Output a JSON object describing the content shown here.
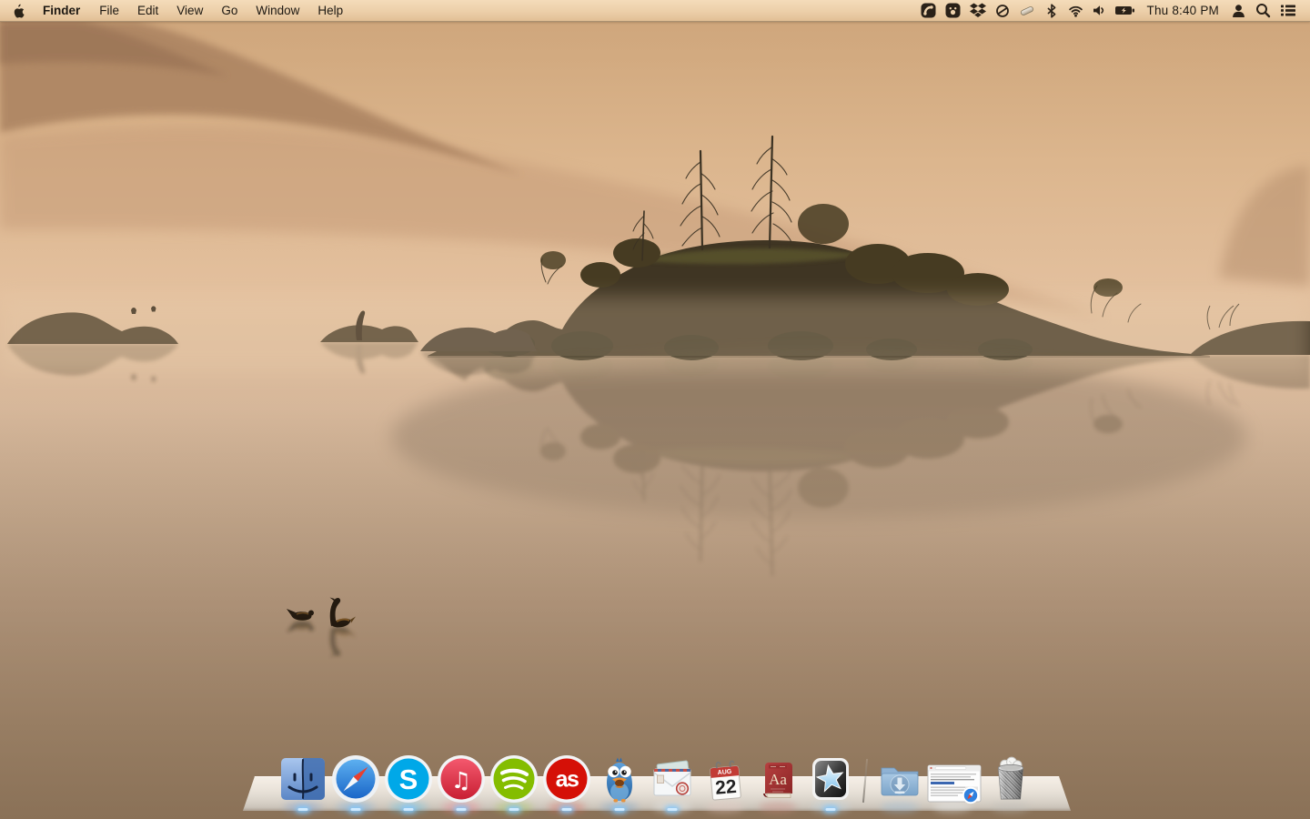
{
  "menu_bar": {
    "items": [
      {
        "label": "Finder",
        "bold": true
      },
      {
        "label": "File"
      },
      {
        "label": "Edit"
      },
      {
        "label": "View"
      },
      {
        "label": "Go"
      },
      {
        "label": "Window"
      },
      {
        "label": "Help"
      }
    ],
    "status": {
      "clock": "Thu 8:40 PM",
      "icons_left_to_right": [
        "phone-icon",
        "rounded-app-icon",
        "dropbox-icon",
        "circle-slash-icon",
        "pill-icon",
        "bluetooth-icon",
        "wifi-icon",
        "volume-icon",
        "battery-icon"
      ],
      "icons_after_clock": [
        "user-icon",
        "spotlight-icon",
        "notification-center-icon"
      ]
    }
  },
  "dock": {
    "items": [
      {
        "name": "finder",
        "running": true,
        "accent": "#5d87c6"
      },
      {
        "name": "safari",
        "running": true,
        "accent": "#2f7fd0"
      },
      {
        "name": "skype",
        "glyph": "S",
        "running": true,
        "accent": "#00a8e8"
      },
      {
        "name": "itunes",
        "glyph": "♫",
        "running": true,
        "accent": "#e83a50"
      },
      {
        "name": "spotify",
        "running": true,
        "accent": "#84bd00"
      },
      {
        "name": "lastfm",
        "glyph": "as",
        "running": true,
        "accent": "#d51007"
      },
      {
        "name": "twitterrific",
        "running": true,
        "accent": "#2f72b5"
      },
      {
        "name": "mail",
        "running": true,
        "accent": "#e7edef"
      },
      {
        "name": "calendar",
        "badge_month": "AUG",
        "badge_day": "22",
        "running": false,
        "accent": "#c23b35"
      },
      {
        "name": "dictionary",
        "glyph": "Aa",
        "running": false,
        "accent": "#a03030"
      },
      {
        "name": "star-app",
        "running": true,
        "accent": "#8bc7ef"
      },
      {
        "name": "downloads-folder",
        "running": false,
        "accent": "#86aed2"
      },
      {
        "name": "webpage-window",
        "running": false,
        "accent": "#f4f6f7"
      },
      {
        "name": "trash",
        "state": "full",
        "running": false,
        "accent": "#ababa6"
      }
    ]
  },
  "wallpaper": {
    "scene": "Misty lake at dusk: tree-topped island with mirror reflection, foreground rocks with small birds, two ducks, hazy hills upper left",
    "sky_top": "#d3ab81",
    "haze_mid": "#e3c09e",
    "water_bottom": "#8a7157",
    "silhouette": "#3f3523"
  }
}
